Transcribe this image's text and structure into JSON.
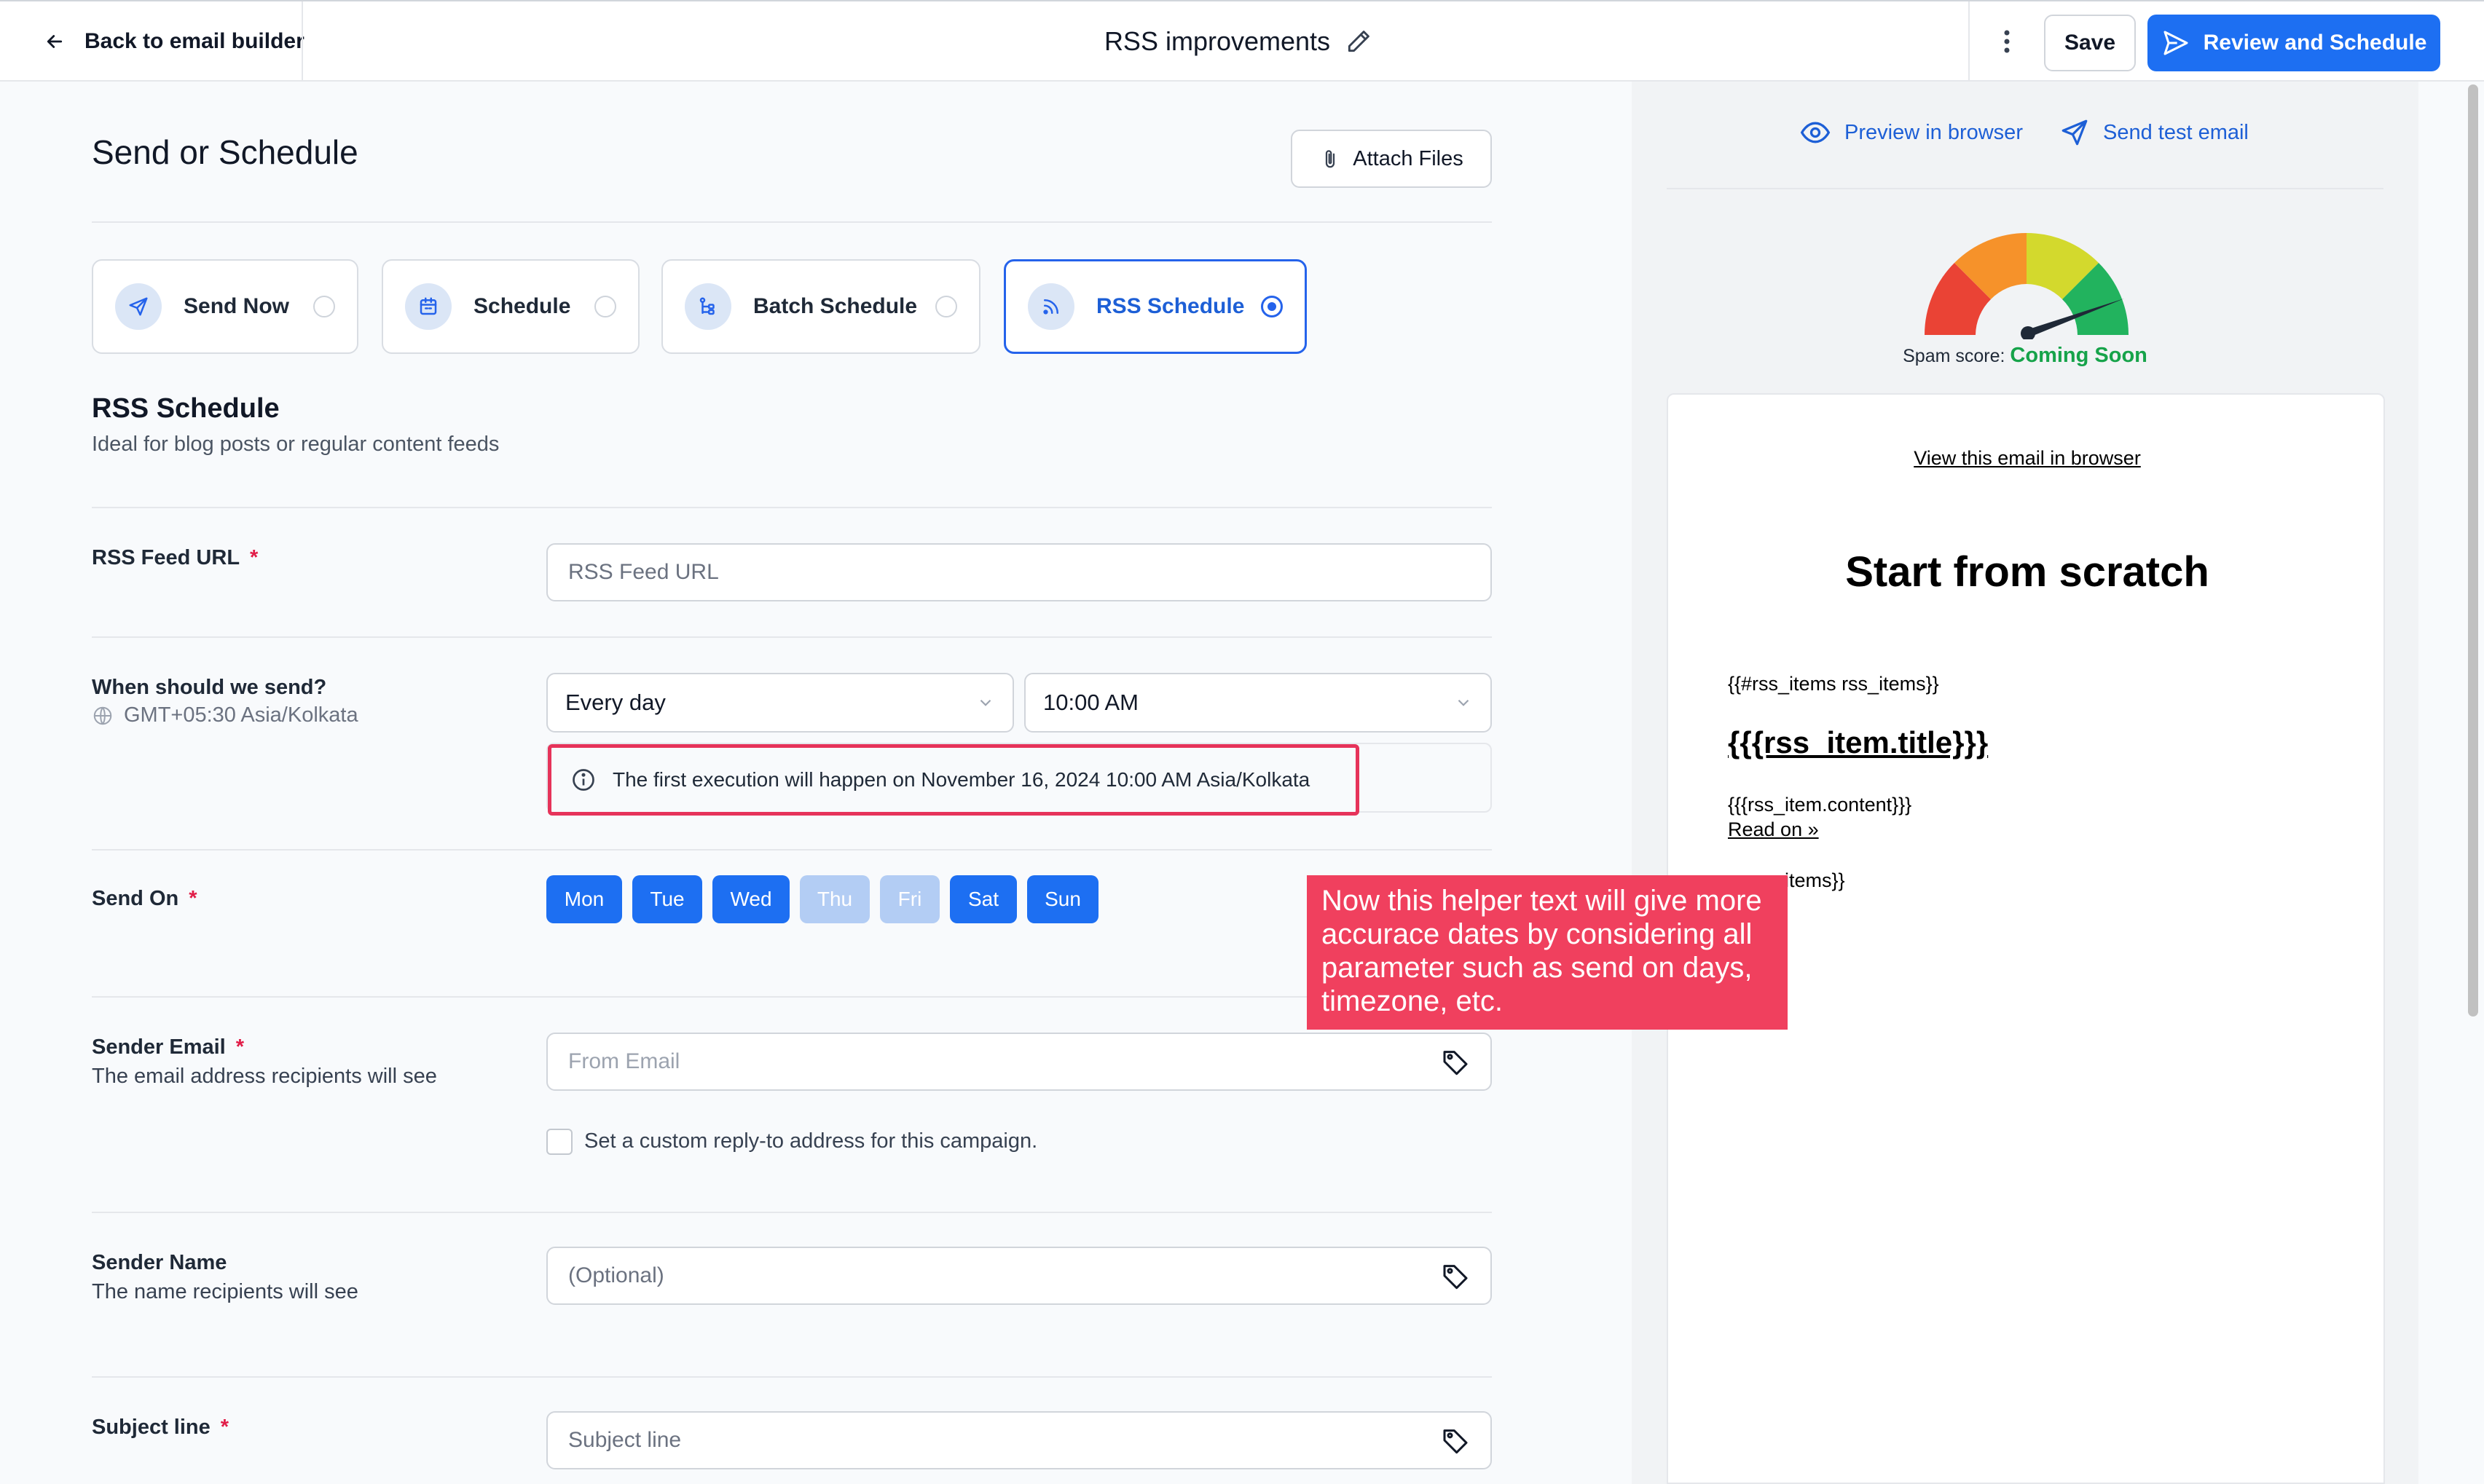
{
  "header": {
    "back_label": "Back to email builder",
    "title": "RSS improvements",
    "save_label": "Save",
    "review_label": "Review and Schedule"
  },
  "main": {
    "page_title": "Send or Schedule",
    "attach_label": "Attach Files",
    "options": [
      {
        "label": "Send Now",
        "icon": "send-icon",
        "selected": false
      },
      {
        "label": "Schedule",
        "icon": "calendar-icon",
        "selected": false
      },
      {
        "label": "Batch Schedule",
        "icon": "batch-icon",
        "selected": false
      },
      {
        "label": "RSS Schedule",
        "icon": "rss-icon",
        "selected": true
      }
    ],
    "section_title": "RSS Schedule",
    "section_subtitle": "Ideal for blog posts or regular content feeds"
  },
  "form": {
    "rss_label": "RSS Feed URL",
    "rss_placeholder": "RSS Feed URL",
    "when_label": "When should we send?",
    "timezone": "GMT+05:30 Asia/Kolkata",
    "frequency": "Every day",
    "time": "10:00 AM",
    "info_text": "The first execution will happen on November 16, 2024 10:00 AM Asia/Kolkata",
    "send_on_label": "Send On",
    "days": [
      {
        "label": "Mon",
        "active": true
      },
      {
        "label": "Tue",
        "active": true
      },
      {
        "label": "Wed",
        "active": true
      },
      {
        "label": "Thu",
        "active": false
      },
      {
        "label": "Fri",
        "active": false
      },
      {
        "label": "Sat",
        "active": true
      },
      {
        "label": "Sun",
        "active": true
      }
    ],
    "sender_email_label": "Sender Email",
    "sender_email_help": "The email address recipients will see",
    "sender_email_placeholder": "From Email",
    "reply_to_label": "Set a custom reply-to address for this campaign.",
    "sender_name_label": "Sender Name",
    "sender_name_help": "The name recipients will see",
    "sender_name_placeholder": "(Optional)",
    "subject_label": "Subject line",
    "subject_placeholder": "Subject line",
    "required_mark": "*"
  },
  "annotation": {
    "text": "Now this helper text will give more accurace dates by considering all parameter such as send on days, timezone, etc."
  },
  "preview_panel": {
    "preview_browser_label": "Preview in browser",
    "send_test_label": "Send test email",
    "spam_label": "Spam score:",
    "spam_value": "Coming Soon",
    "email": {
      "view_link": "View this email in browser",
      "heading": "Start from scratch",
      "rss_open": "{{#rss_items rss_items}}",
      "item_title": "{{{rss_item.title}}}",
      "item_content": "{{{rss_item.content}}}",
      "read_on": "Read on »",
      "rss_close_partial": "items}}"
    }
  },
  "colors": {
    "primary": "#1d6ff2",
    "annotation": "#f0405e",
    "success": "#16a34a"
  }
}
